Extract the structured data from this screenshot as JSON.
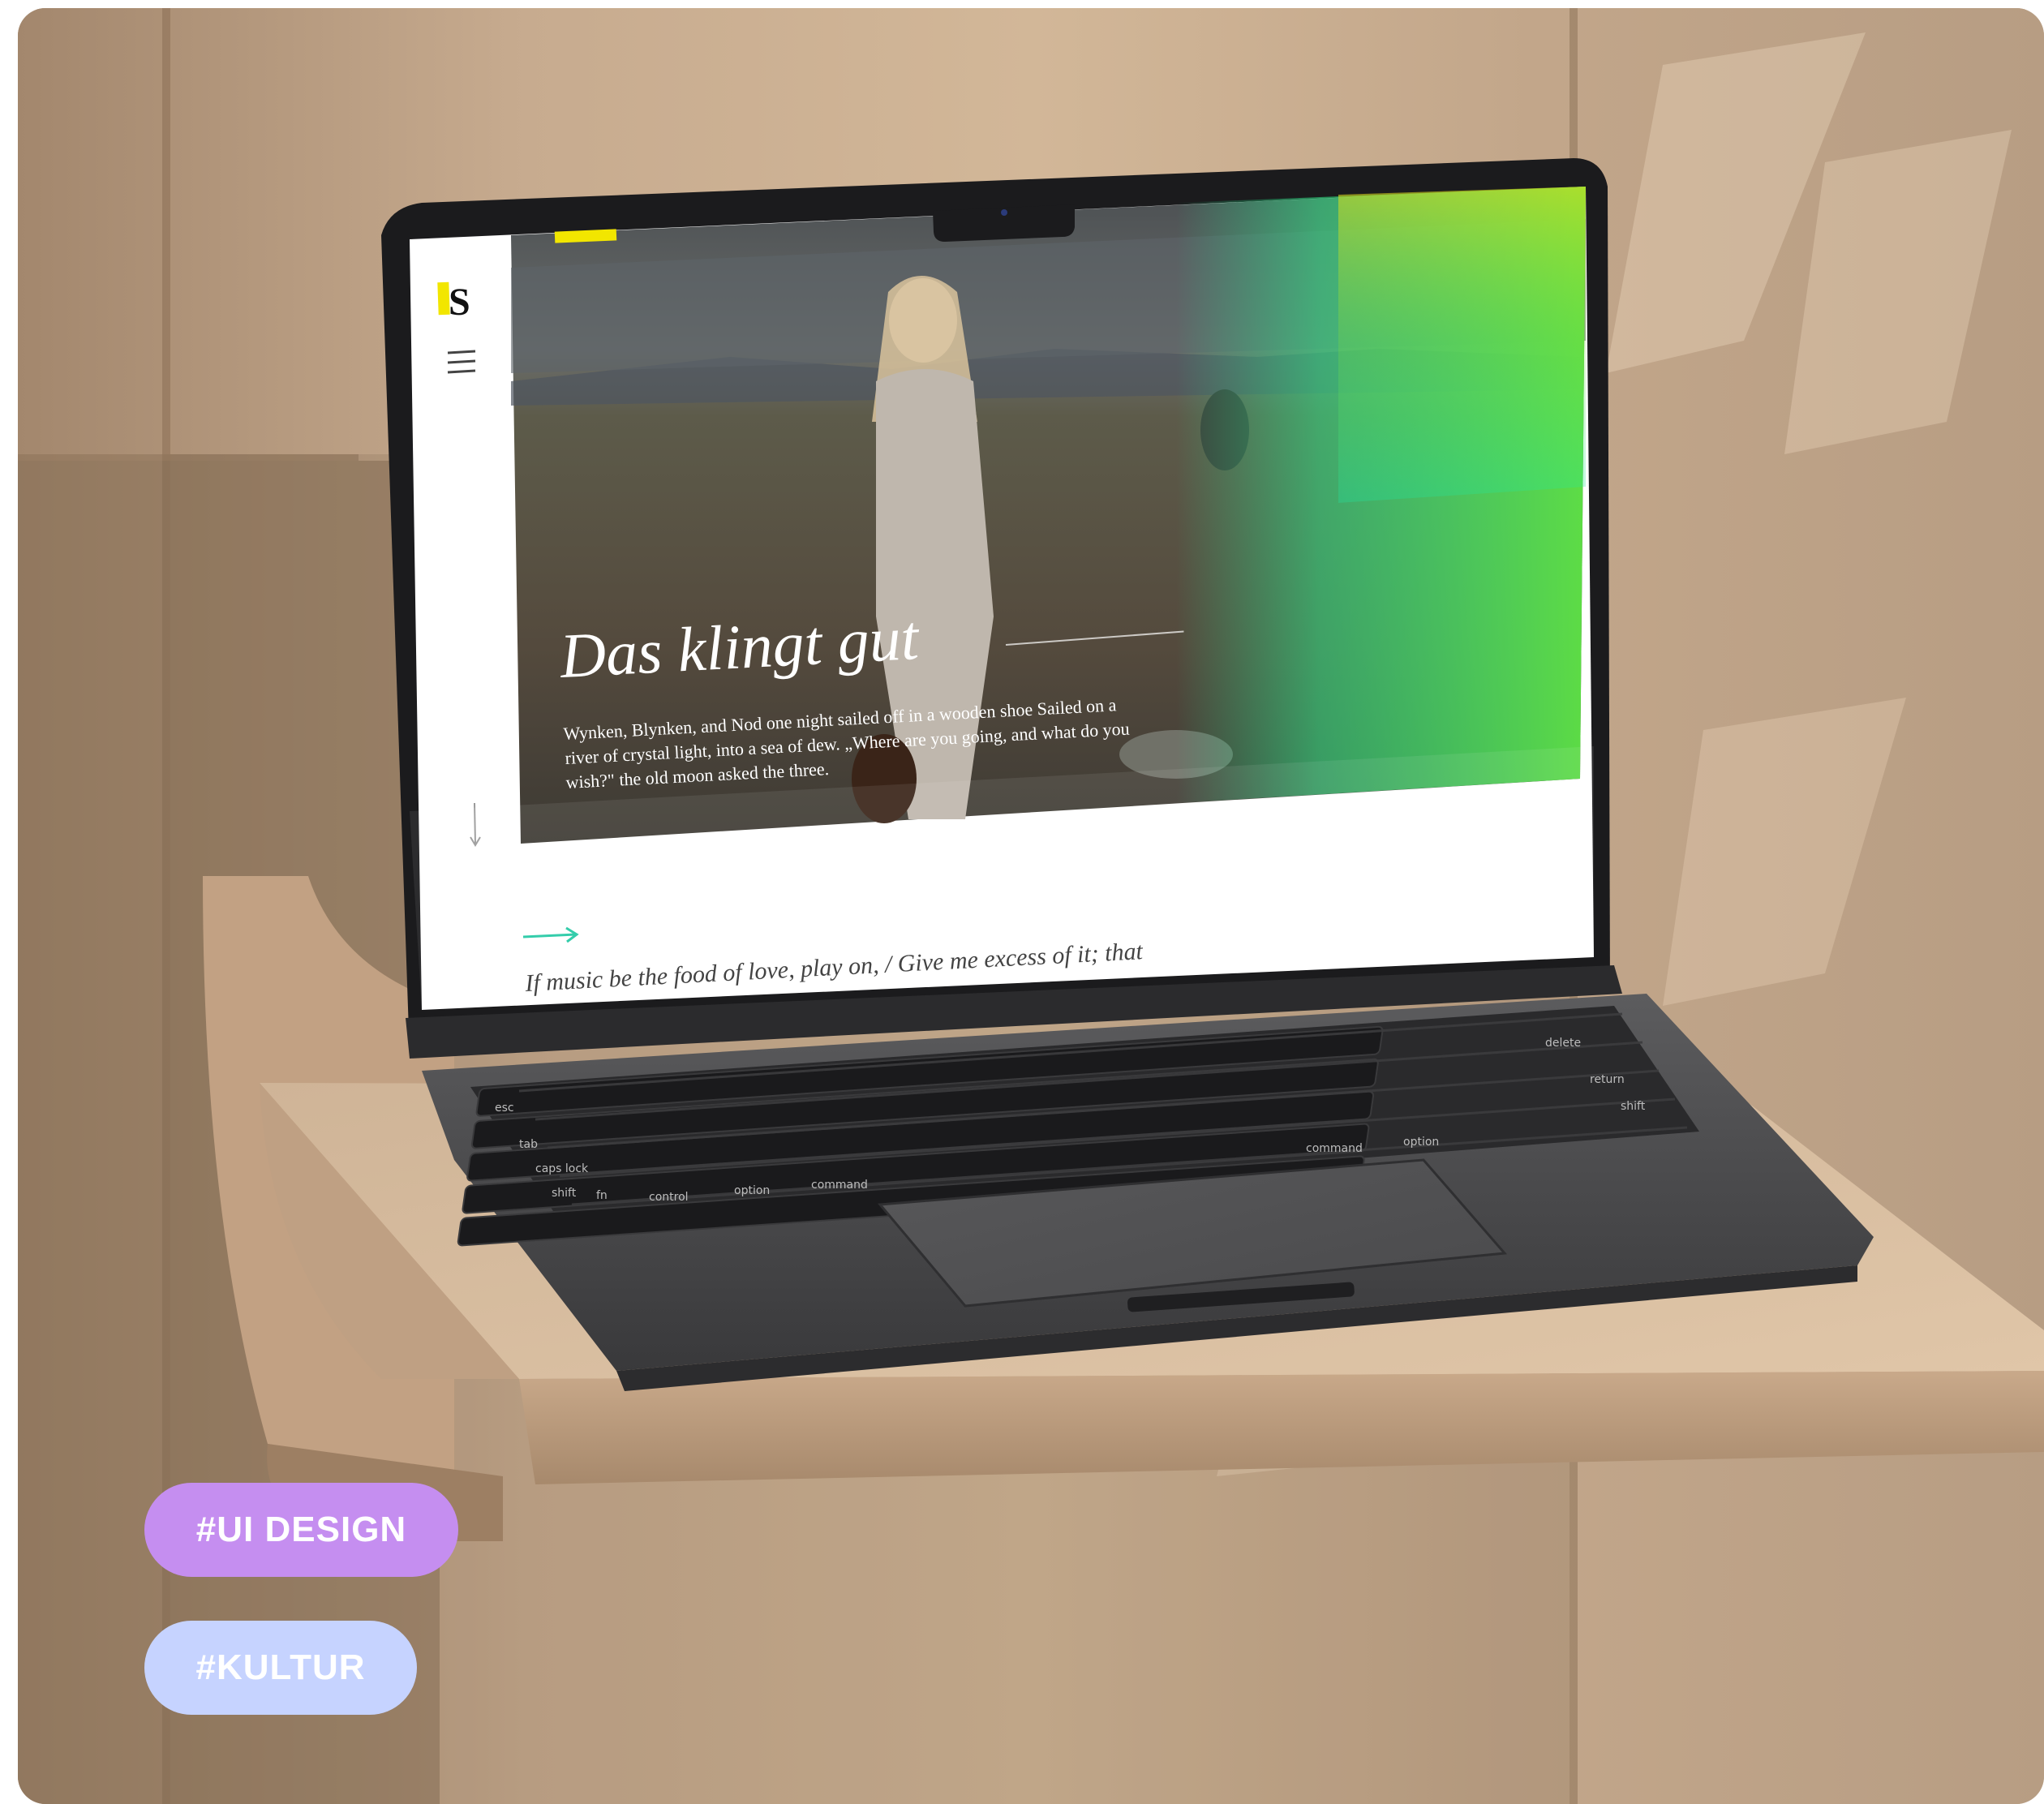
{
  "tags": [
    {
      "label": "#UI DESIGN",
      "color": "#c58ef0"
    },
    {
      "label": "#KULTUR",
      "color": "#c6d3ff"
    }
  ],
  "screen": {
    "logo_letter": "S",
    "hero_title": "Das klingt gut",
    "hero_body_lines": [
      "Wynken, Blynken, and Nod one night sailed off in a wooden shoe Sailed on a",
      "river of crystal light, into a sea of dew. „Where are you going, and what do you",
      "wish?\" the old moon asked the three."
    ],
    "quote": "If music be the food of love, play on, / Give me excess of it; that",
    "accent_yellow": "#f2e600",
    "accent_teal": "#23c9a4",
    "gradient_colors": [
      "#d9e21a",
      "#4fd95b",
      "#14e8a0"
    ]
  },
  "keyboard": {
    "keys": [
      "esc",
      "tab",
      "caps lock",
      "shift",
      "fn",
      "control",
      "option",
      "command",
      "command",
      "option",
      "delete",
      "return",
      "shift"
    ]
  }
}
